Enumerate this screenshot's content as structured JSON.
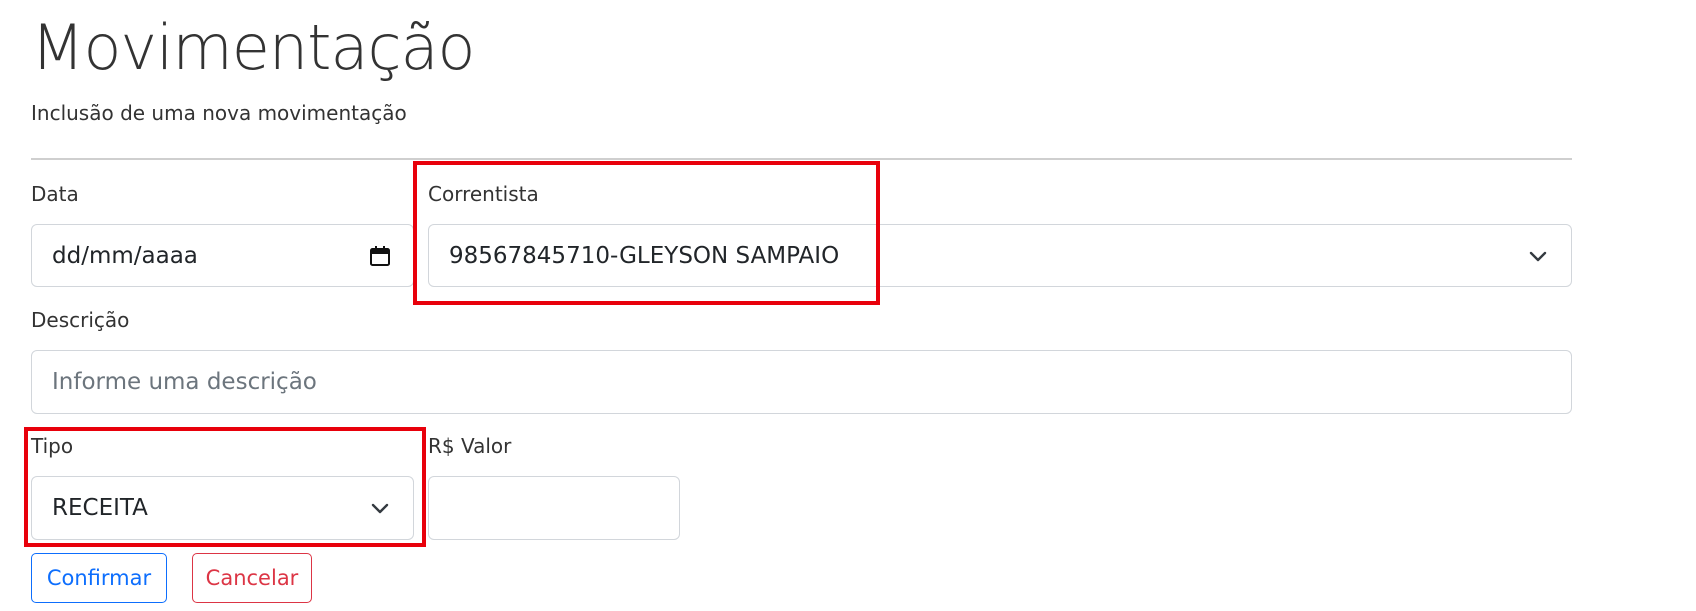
{
  "header": {
    "title": "Movimentação",
    "subtitle": "Inclusão de uma nova movimentação"
  },
  "form": {
    "data": {
      "label": "Data",
      "value": "dd/mm/aaaa",
      "icon": "calendar-icon"
    },
    "correntista": {
      "label": "Correntista",
      "selected": "98567845710-GLEYSON SAMPAIO",
      "icon": "chevron-down-icon"
    },
    "descricao": {
      "label": "Descrição",
      "placeholder": "Informe uma descrição",
      "value": ""
    },
    "tipo": {
      "label": "Tipo",
      "selected": "RECEITA",
      "icon": "chevron-down-icon"
    },
    "valor": {
      "label": "R$ Valor",
      "value": ""
    }
  },
  "actions": {
    "confirm_label": "Confirmar",
    "cancel_label": "Cancelar"
  },
  "colors": {
    "highlight": "#e8000b",
    "primary": "#0d6efd",
    "danger": "#dc3545",
    "divider": "#cfcfcf"
  }
}
